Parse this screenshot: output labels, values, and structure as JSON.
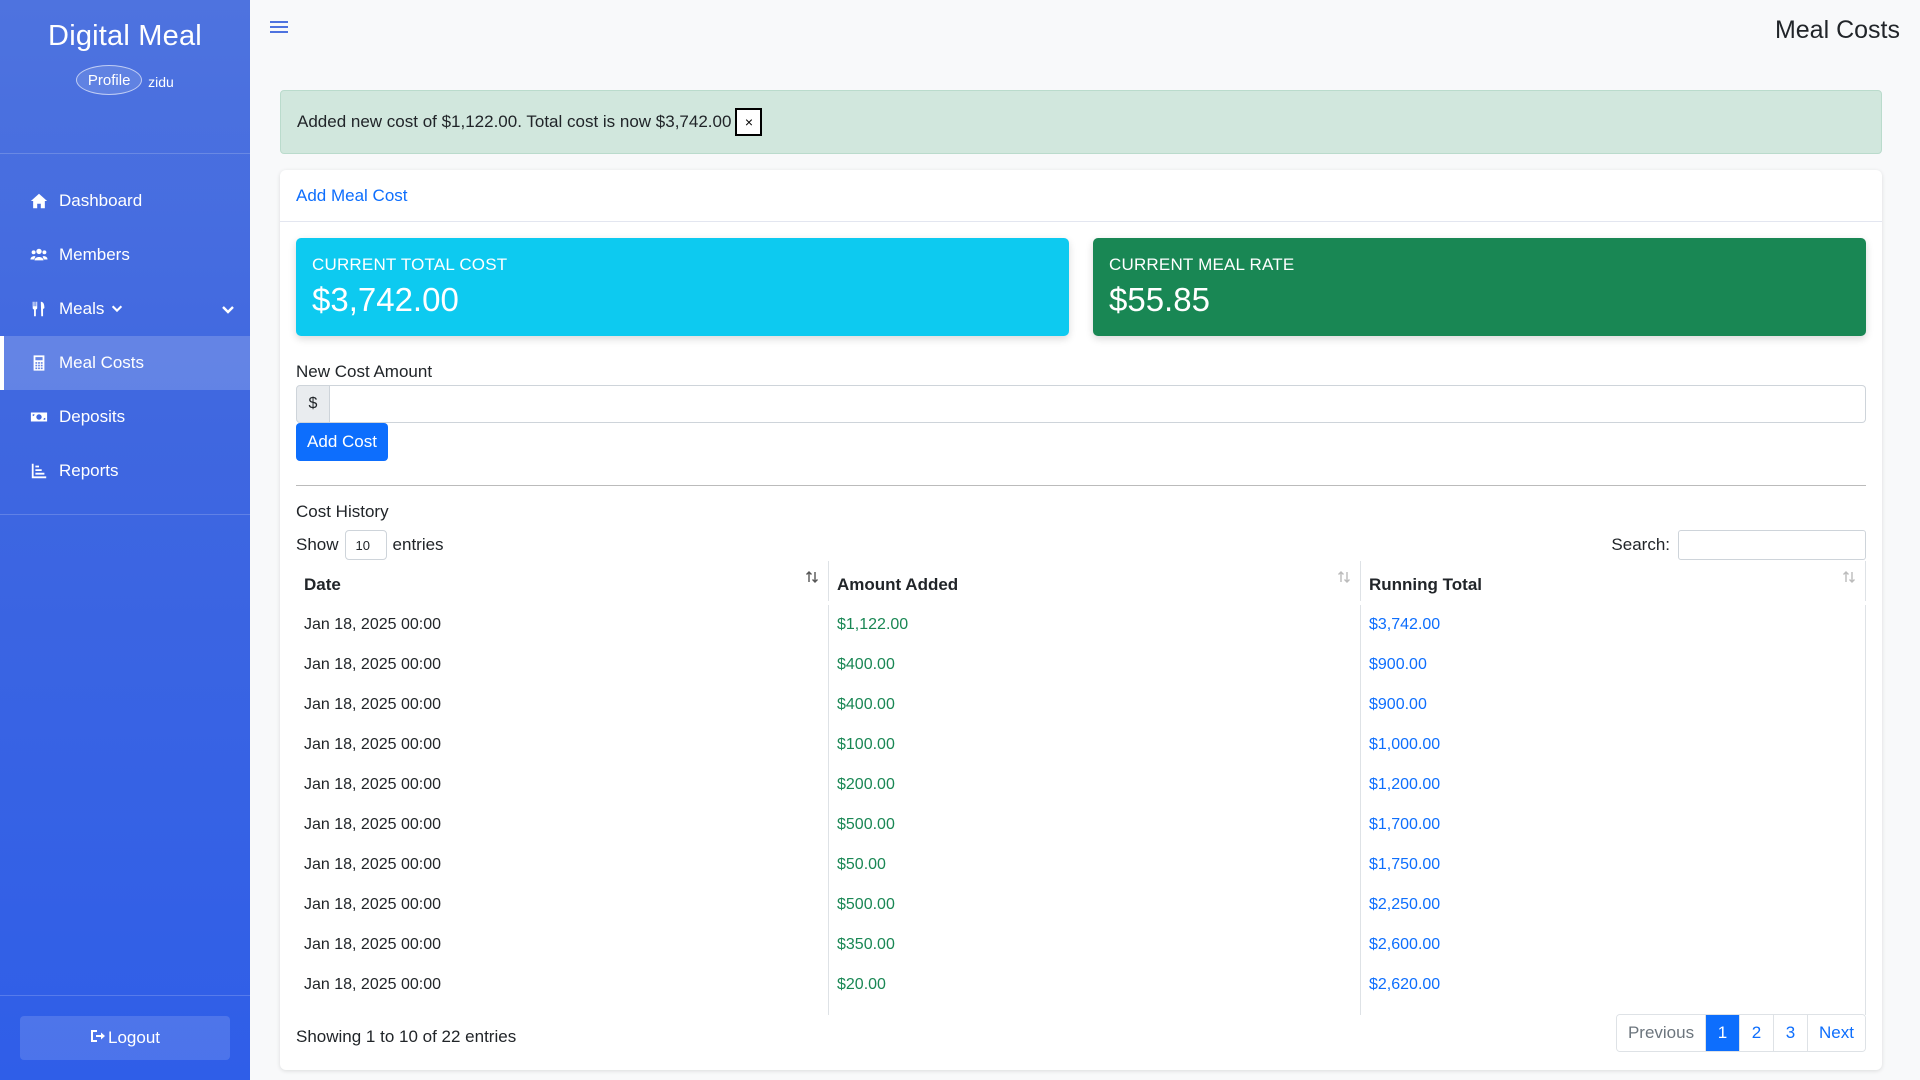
{
  "sidebar": {
    "brand": "Digital Meal",
    "profile_pic_alt": "Profile",
    "username": "zidu",
    "items": [
      {
        "label": "Dashboard",
        "icon": "home-icon"
      },
      {
        "label": "Members",
        "icon": "users-icon"
      },
      {
        "label": "Meals",
        "icon": "utensils-icon"
      },
      {
        "label": "Meal Costs",
        "icon": "calculator-icon"
      },
      {
        "label": "Deposits",
        "icon": "money-icon"
      },
      {
        "label": "Reports",
        "icon": "chart-icon"
      }
    ],
    "active_item": "Meal Costs",
    "logout_label": "Logout"
  },
  "topbar": {
    "title": "Meal Costs"
  },
  "alert": {
    "text": "Added new cost of $1,122.00. Total cost is now $3,742.00",
    "close_label": "×",
    "color": "#d1e7dd"
  },
  "card": {
    "header_link": "Add Meal Cost",
    "stats": {
      "total_cost_label": "CURRENT TOTAL COST",
      "total_cost_value": "$3,742.00",
      "total_cost_color": "#0dcaf0",
      "meal_rate_label": "CURRENT MEAL RATE",
      "meal_rate_value": "$55.85",
      "meal_rate_color": "#198754"
    },
    "form": {
      "label": "New Cost Amount",
      "prefix": "$",
      "value": "",
      "submit_label": "Add Cost"
    },
    "history": {
      "title": "Cost History",
      "show_label": "Show",
      "entries_value": "10",
      "entries_label": "entries",
      "search_label": "Search:",
      "search_value": "",
      "columns": [
        "Date",
        "Amount Added",
        "Running Total"
      ],
      "rows": [
        {
          "date": "Jan 18, 2025 00:00",
          "amount": "$1,122.00",
          "total": "$3,742.00"
        },
        {
          "date": "Jan 18, 2025 00:00",
          "amount": "$400.00",
          "total": "$900.00"
        },
        {
          "date": "Jan 18, 2025 00:00",
          "amount": "$400.00",
          "total": "$900.00"
        },
        {
          "date": "Jan 18, 2025 00:00",
          "amount": "$100.00",
          "total": "$1,000.00"
        },
        {
          "date": "Jan 18, 2025 00:00",
          "amount": "$200.00",
          "total": "$1,200.00"
        },
        {
          "date": "Jan 18, 2025 00:00",
          "amount": "$500.00",
          "total": "$1,700.00"
        },
        {
          "date": "Jan 18, 2025 00:00",
          "amount": "$50.00",
          "total": "$1,750.00"
        },
        {
          "date": "Jan 18, 2025 00:00",
          "amount": "$500.00",
          "total": "$2,250.00"
        },
        {
          "date": "Jan 18, 2025 00:00",
          "amount": "$350.00",
          "total": "$2,600.00"
        },
        {
          "date": "Jan 18, 2025 00:00",
          "amount": "$20.00",
          "total": "$2,620.00"
        }
      ],
      "info": "Showing 1 to 10 of 22 entries",
      "pagination": {
        "previous": "Previous",
        "pages": [
          "1",
          "2",
          "3"
        ],
        "current": "1",
        "next": "Next"
      }
    }
  }
}
